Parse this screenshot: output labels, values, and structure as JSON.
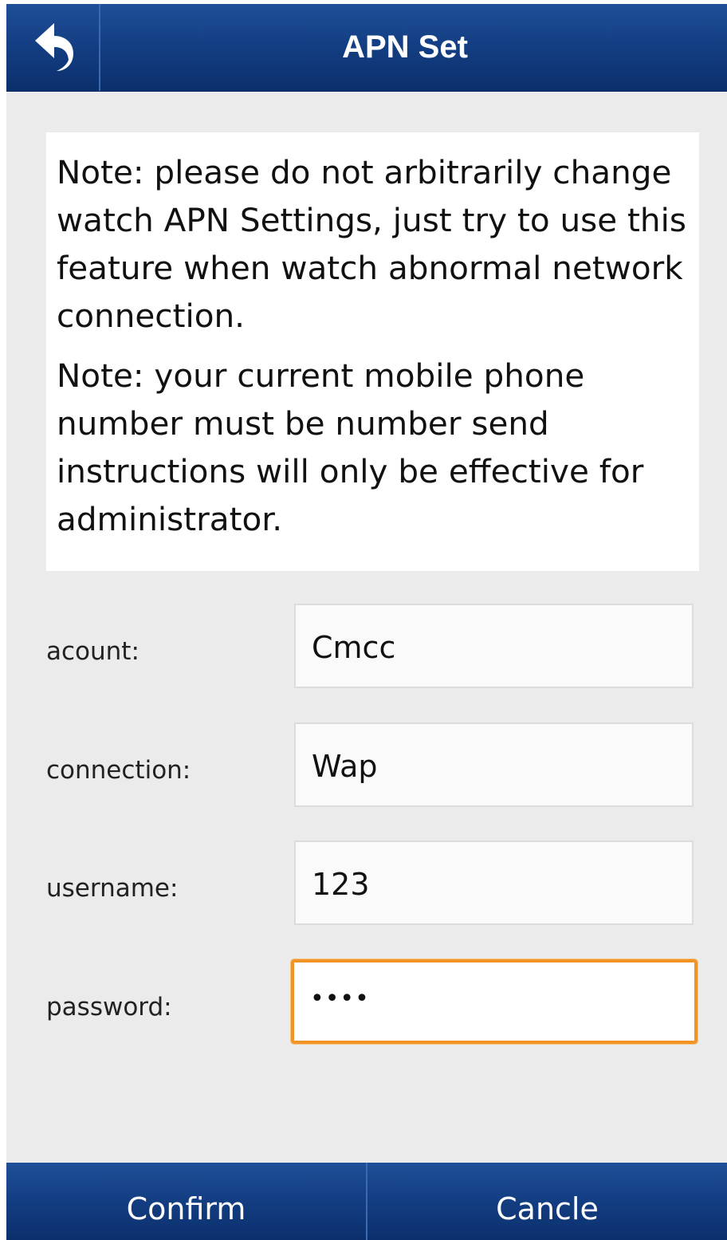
{
  "header": {
    "title": "APN Set",
    "back_icon": "back-arrow-icon"
  },
  "notes": [
    "Note: please do not arbitrarily change watch APN Settings, just try to use this feature when watch abnormal network connection.",
    "Note: your current mobile phone number must be number send instructions will only be effective for administrator."
  ],
  "form": {
    "account": {
      "label": "acount:",
      "value": "Cmcc"
    },
    "connection": {
      "label": "connection:",
      "value": "Wap"
    },
    "username": {
      "label": "username:",
      "value": "123"
    },
    "password": {
      "label": "password:",
      "masked_value": "••••"
    }
  },
  "buttons": {
    "confirm": "Confirm",
    "cancel": "Cancle"
  },
  "colors": {
    "header_bg": "#143f84",
    "focus_border": "#f29425",
    "screen_bg": "#ebebeb"
  }
}
